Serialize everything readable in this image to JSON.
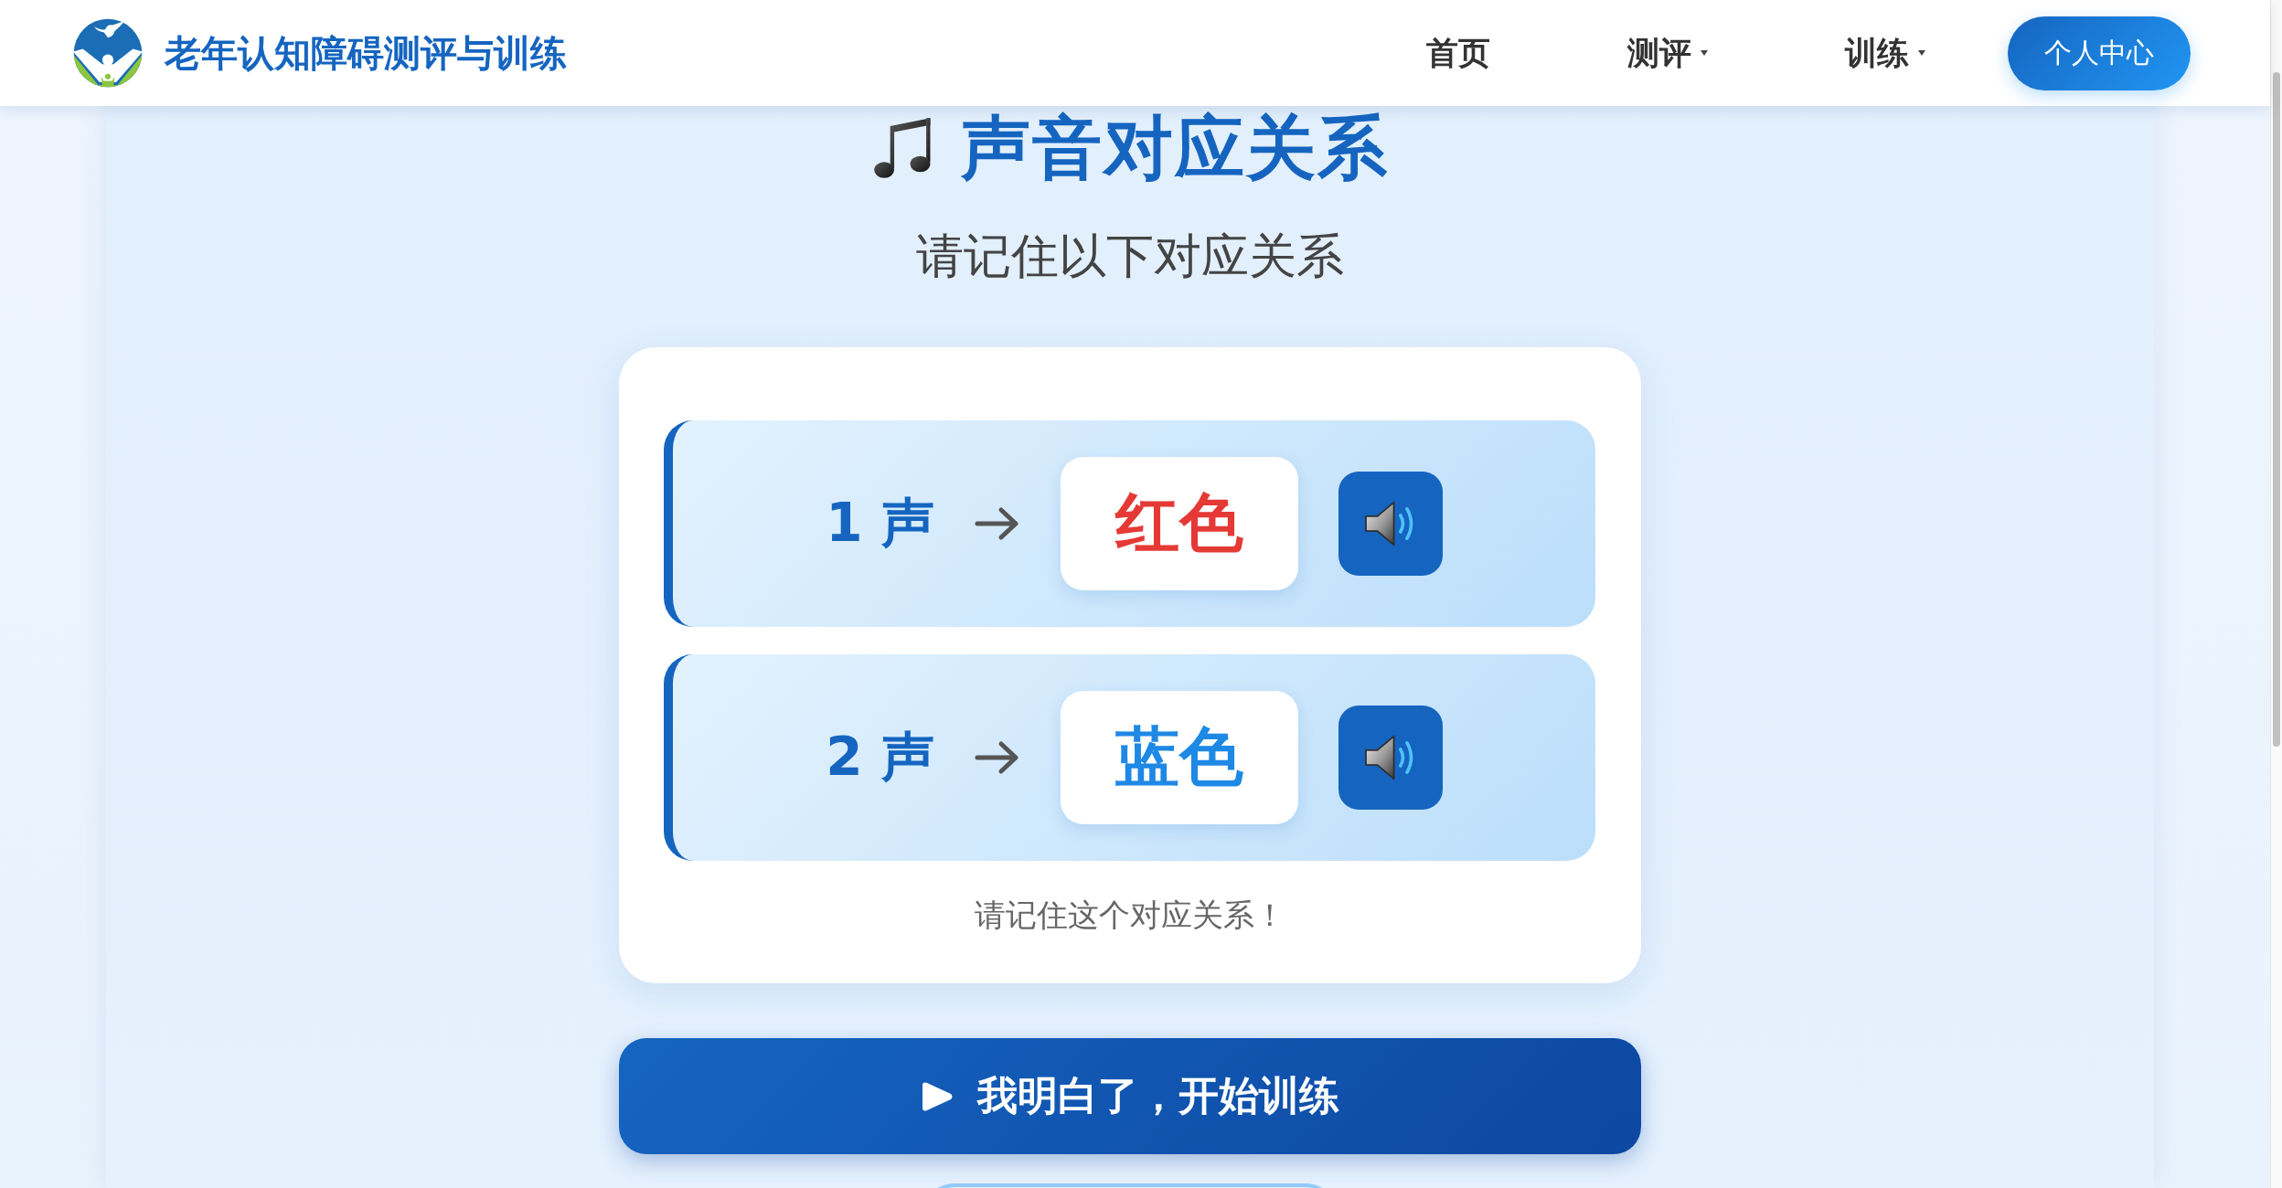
{
  "header": {
    "title": "老年认知障碍测评与训练",
    "nav": [
      {
        "label": "首页",
        "dropdown": false
      },
      {
        "label": "测评",
        "dropdown": true
      },
      {
        "label": "训练",
        "dropdown": true
      }
    ],
    "account_button": "个人中心"
  },
  "page": {
    "title": "声音对应关系",
    "subtitle": "请记住以下对应关系"
  },
  "pairs": [
    {
      "sound": "1 声",
      "color_name": "红色",
      "color": "#e53935"
    },
    {
      "sound": "2 声",
      "color_name": "蓝色",
      "color": "#1e88e5"
    }
  ],
  "hint": "请记住这个对应关系！",
  "start_button": "我明白了，开始训练"
}
